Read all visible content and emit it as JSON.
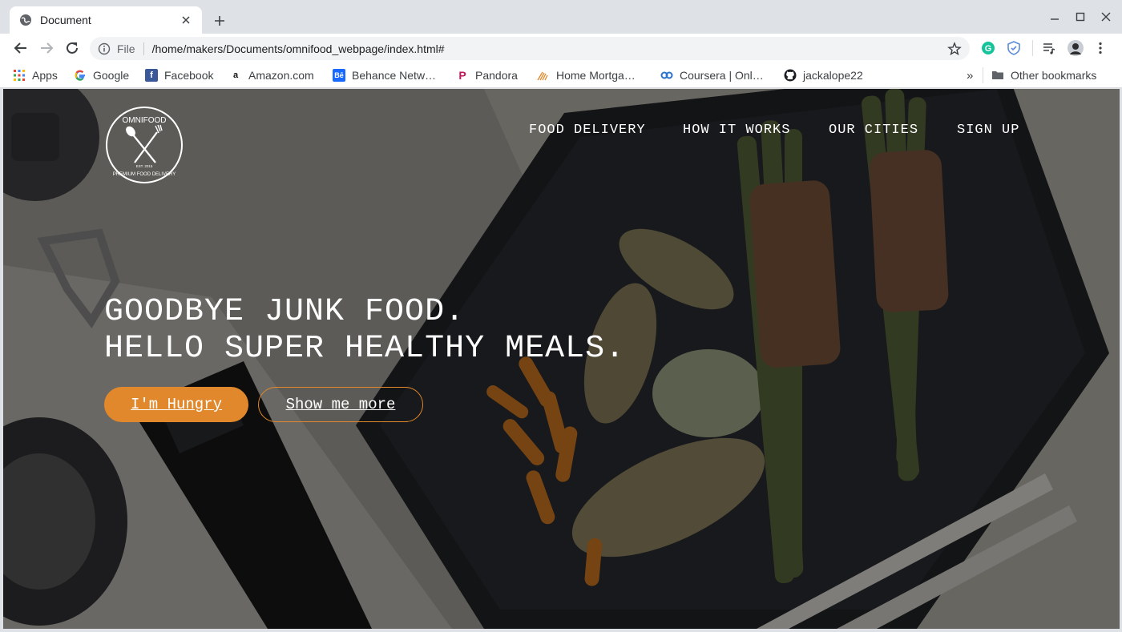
{
  "browser": {
    "tab_title": "Document",
    "url_scheme": "File",
    "url": "/home/makers/Documents/omnifood_webpage/index.html#",
    "bookmarks": [
      {
        "label": "Apps",
        "icon": "apps-grid-icon"
      },
      {
        "label": "Google",
        "icon": "google-icon",
        "color": "#4285f4"
      },
      {
        "label": "Facebook",
        "icon": "facebook-icon",
        "color": "#3b5998"
      },
      {
        "label": "Amazon.com",
        "icon": "amazon-icon"
      },
      {
        "label": "Behance Netw…",
        "icon": "behance-icon",
        "color": "#1769ff"
      },
      {
        "label": "Pandora",
        "icon": "pandora-icon",
        "color": "#c2185b"
      },
      {
        "label": "Home Mortga…",
        "icon": "home-mortgage-icon",
        "color": "#e0882b"
      },
      {
        "label": "Coursera | Onl…",
        "icon": "coursera-icon",
        "color": "#2a73cc"
      },
      {
        "label": "jackalope22",
        "icon": "github-icon"
      }
    ],
    "overflow_label": "»",
    "other_bookmarks": "Other bookmarks"
  },
  "site": {
    "logo_text_top": "OMNIFOOD",
    "logo_text_bottom": "PREMIUM FOOD DELIVERY",
    "logo_est": "EST. 2015",
    "nav": [
      "FOOD DELIVERY",
      "HOW IT WORKS",
      "OUR CITIES",
      "SIGN UP"
    ],
    "hero_line1": "GOODBYE JUNK FOOD.",
    "hero_line2": "HELLO SUPER HEALTHY MEALS.",
    "btn_primary": "I'm Hungry",
    "btn_secondary": "Show me more",
    "accent_color": "#e0882b"
  }
}
